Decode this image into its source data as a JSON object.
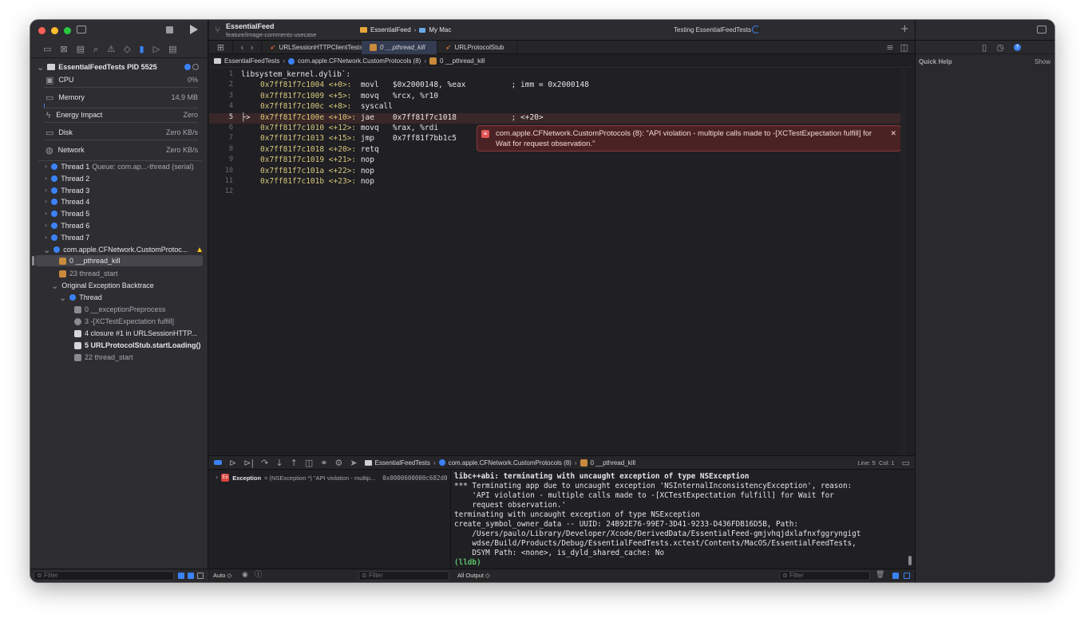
{
  "titlebar": {
    "project": "EssentialFeed",
    "branch": "feature/image-comments-usecase",
    "scheme": "EssentialFeed",
    "destination": "My Mac",
    "status": "Testing EssentialFeedTests"
  },
  "navigator": {
    "process": "EssentialFeedTests PID 5525",
    "gauges": [
      {
        "label": "CPU",
        "value": "0%"
      },
      {
        "label": "Memory",
        "value": "14,9 MB"
      },
      {
        "label": "Energy Impact",
        "value": "Zero"
      },
      {
        "label": "Disk",
        "value": "Zero KB/s"
      },
      {
        "label": "Network",
        "value": "Zero KB/s"
      }
    ],
    "threads": [
      {
        "label": "Thread 1",
        "detail": "Queue: com.ap...-thread (serial)"
      },
      {
        "label": "Thread 2",
        "detail": ""
      },
      {
        "label": "Thread 3",
        "detail": ""
      },
      {
        "label": "Thread 4",
        "detail": ""
      },
      {
        "label": "Thread 5",
        "detail": ""
      },
      {
        "label": "Thread 6",
        "detail": ""
      },
      {
        "label": "Thread 7",
        "detail": ""
      }
    ],
    "crashed_thread": "com.apple.CFNetwork.CustomProtoc...",
    "frames": [
      {
        "label": "0 __pthread_kill"
      },
      {
        "label": "23 thread_start"
      }
    ],
    "backtrace_header": "Original Exception Backtrace",
    "backtrace_thread": "Thread",
    "backtrace_frames": [
      {
        "label": "0 __exceptionPreprocess"
      },
      {
        "label": "3 -[XCTestExpectation fulfill]"
      },
      {
        "label": "4 closure #1 in URLSessionHTTP..."
      },
      {
        "label": "5 URLProtocolStub.startLoading()"
      },
      {
        "label": "22 thread_start"
      }
    ],
    "filter_placeholder": "Filter"
  },
  "tabs": [
    {
      "label": "URLSessionHTTPClientTests"
    },
    {
      "label": "0 __pthread_kill"
    },
    {
      "label": "URLProtocolStub"
    }
  ],
  "jumpbar": {
    "target": "EssentialFeedTests",
    "thread": "com.apple.CFNetwork.CustomProtocols (8)",
    "frame": "0 __pthread_kill"
  },
  "code_lines": [
    {
      "n": "1",
      "addr": "",
      "rest": "libsystem_kernel.dylib`:"
    },
    {
      "n": "2",
      "addr": "0x7ff81f7c1004 <+0>: ",
      "rest": " movl   $0x2000148, %eax          ; imm = 0x2000148"
    },
    {
      "n": "3",
      "addr": "0x7ff81f7c1009 <+5>: ",
      "rest": " movq   %rcx, %r10"
    },
    {
      "n": "4",
      "addr": "0x7ff81f7c100c <+8>: ",
      "rest": " syscall"
    },
    {
      "n": "5",
      "addr": "0x7ff81f7c100e <+10>:",
      "rest": " jae    0x7ff81f7c1018            ; <+20>"
    },
    {
      "n": "6",
      "addr": "0x7ff81f7c1010 <+12>:",
      "rest": " movq   %rax, %rdi"
    },
    {
      "n": "7",
      "addr": "0x7ff81f7c1013 <+15>:",
      "rest": " jmp    0x7ff81f7bb1c5"
    },
    {
      "n": "8",
      "addr": "0x7ff81f7c1018 <+20>:",
      "rest": " retq"
    },
    {
      "n": "9",
      "addr": "0x7ff81f7c1019 <+21>:",
      "rest": " nop"
    },
    {
      "n": "10",
      "addr": "0x7ff81f7c101a <+22>:",
      "rest": " nop"
    },
    {
      "n": "11",
      "addr": "0x7ff81f7c101b <+23>:",
      "rest": " nop"
    },
    {
      "n": "12",
      "addr": "",
      "rest": ""
    }
  ],
  "error_message": "com.apple.CFNetwork.CustomProtocols (8): \"API violation - multiple calls made to -[XCTestExpectation fulfill] for Wait for request observation.\"",
  "debug_bar": {
    "target": "EssentialFeedTests",
    "thread": "com.apple.CFNetwork.CustomProtocols (8)",
    "frame": "0 __pthread_kill",
    "position": "Line: 5  Col: 1"
  },
  "variables": {
    "name": "Exception",
    "type": "= (NSException *) \"API violation - multip...",
    "value": "0x0000600000c682d0"
  },
  "console_lines": [
    "libc++abi: terminating with uncaught exception of type NSException",
    "*** Terminating app due to uncaught exception 'NSInternalInconsistencyException', reason:",
    "    'API violation - multiple calls made to -[XCTestExpectation fulfill] for Wait for",
    "    request observation.'",
    "terminating with uncaught exception of type NSException",
    "create_symbol_owner_data -- UUID: 24B92E76-99E7-3D41-9233-D436FDB16D5B, Path:",
    "    /Users/paulo/Library/Developer/Xcode/DerivedData/EssentialFeed-gmjvhqjdxlafnxfggryngigt",
    "    wdse/Build/Products/Debug/EssentialFeedTests.xctest/Contents/MacOS/EssentialFeedTests,",
    "    DSYM Path: <none>, is_dyld_shared_cache: No"
  ],
  "console_prompt": "(lldb)",
  "bottom": {
    "auto_label": "Auto ◇",
    "filter_placeholder": "Filter",
    "output_label": "All Output ◇"
  },
  "inspector": {
    "title": "Quick Help",
    "show": "Show"
  },
  "colors": {
    "error": "#e25353",
    "accent": "#3b82f6",
    "frame": "#c98a3c",
    "highlight": "#3a2727"
  }
}
